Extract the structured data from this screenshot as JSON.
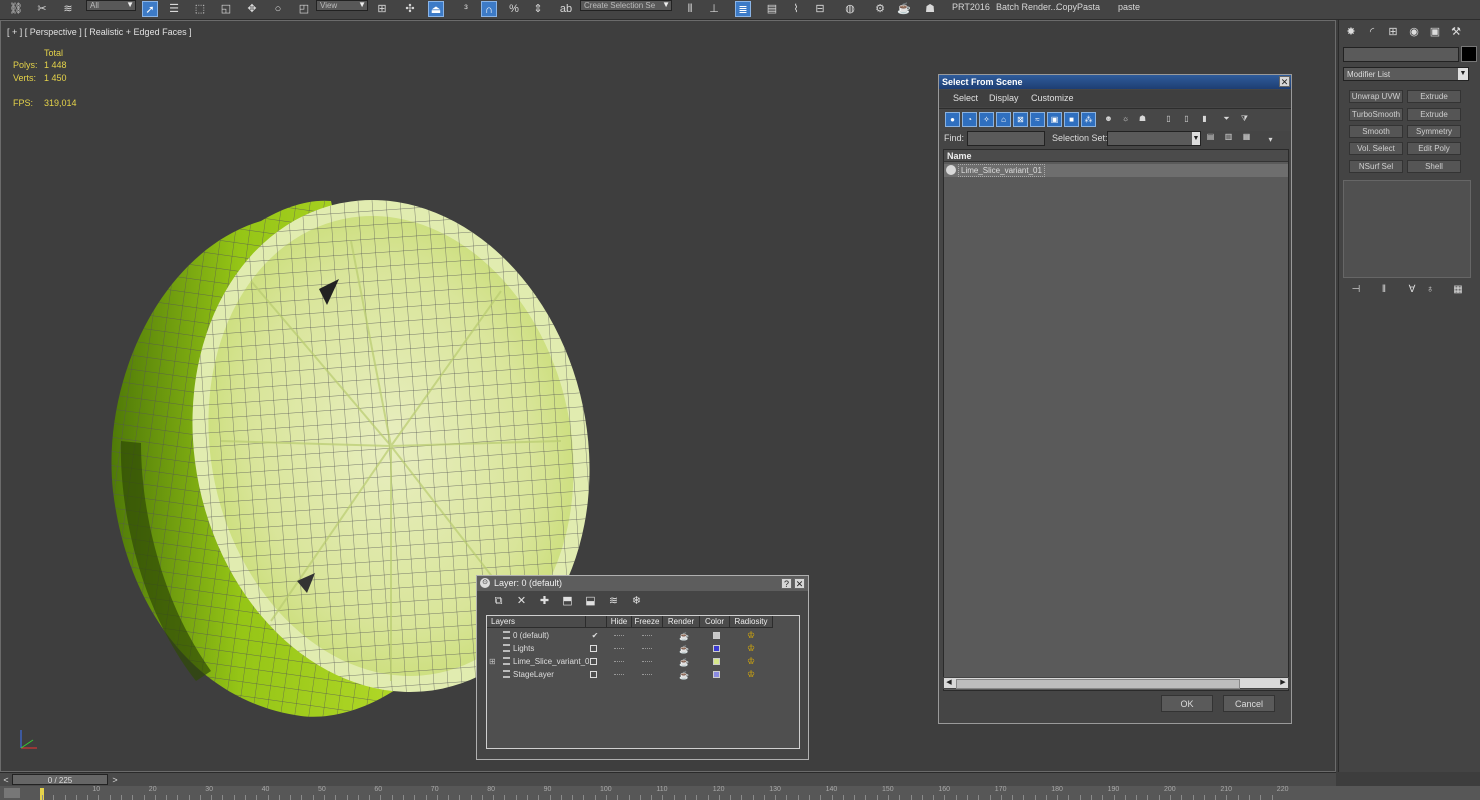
{
  "toolbar": {
    "selection_filter": "All",
    "ref_coord": "View",
    "named_selection_placeholder": "Create Selection Se",
    "custom_labels": [
      "PRT2016",
      "Batch Render...",
      "CopyPasta",
      "paste"
    ]
  },
  "viewport": {
    "label": "[ + ] [ Perspective ] [ Realistic + Edged Faces ]",
    "stats": {
      "total_label": "Total",
      "polys_label": "Polys:",
      "polys_value": "1 448",
      "verts_label": "Verts:",
      "verts_value": "1 450",
      "fps_label": "FPS:",
      "fps_value": "319,014"
    }
  },
  "command_panel": {
    "modifier_list": "Modifier List",
    "modifier_buttons": [
      [
        "Unwrap UVW",
        "Extrude"
      ],
      [
        "TurboSmooth",
        "Extrude"
      ],
      [
        "Smooth",
        "Symmetry"
      ],
      [
        "Vol. Select",
        "Edit Poly"
      ],
      [
        "NSurf Sel",
        "Shell"
      ]
    ]
  },
  "time": {
    "slider_label": "0 / 225",
    "ticks": [
      "10",
      "20",
      "30",
      "40",
      "50",
      "60",
      "70",
      "80",
      "90",
      "100",
      "110",
      "120",
      "130",
      "140",
      "150",
      "160",
      "170",
      "180",
      "190",
      "200",
      "210",
      "220"
    ]
  },
  "select_from_scene": {
    "title": "Select From Scene",
    "menu": [
      "Select",
      "Display",
      "Customize"
    ],
    "find_label": "Find:",
    "selection_set_label": "Selection Set:",
    "column_name": "Name",
    "items": [
      "Lime_Slice_variant_01"
    ],
    "ok": "OK",
    "cancel": "Cancel"
  },
  "layer_dialog": {
    "title": "Layer: 0 (default)",
    "columns": [
      "Layers",
      "Hide",
      "Freeze",
      "Render",
      "Color",
      "Radiosity"
    ],
    "rows": [
      {
        "name": "0 (default)",
        "current": true,
        "color": "#c8c8c8"
      },
      {
        "name": "Lights",
        "current": false,
        "color": "#3a3ad0"
      },
      {
        "name": "Lime_Slice_variant_0",
        "current": false,
        "color": "#d6e88a"
      },
      {
        "name": "StageLayer",
        "current": false,
        "color": "#8a8ae0"
      }
    ]
  },
  "colors": {
    "viewport_bg": "#3e3e3e",
    "stats_text": "#e5d34a",
    "lime_rind": "#9ccc1a",
    "lime_flesh": "#dfe8a8",
    "title_bar": "#2f5c9b"
  }
}
